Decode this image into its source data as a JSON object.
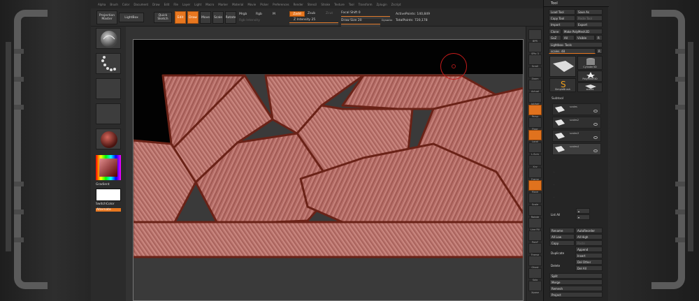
{
  "menu": [
    "Alpha",
    "Brush",
    "Color",
    "Document",
    "Draw",
    "Edit",
    "File",
    "Layer",
    "Light",
    "Macro",
    "Marker",
    "Material",
    "Movie",
    "Picker",
    "Preferences",
    "Render",
    "Stencil",
    "Stroke",
    "Texture",
    "Tool",
    "Transform",
    "Zplugin",
    "Zscript"
  ],
  "toolbar": {
    "projection_master": "Projection Master",
    "lightbox": "LightBox",
    "quick_sketch": "Quick Sketch",
    "edit": "Edit",
    "draw": "Draw",
    "move": "Move",
    "scale": "Scale",
    "rotate": "Rotate",
    "mrgb": "Mrgb",
    "rgb": "Rgb",
    "m": "M",
    "zadd": "Zadd",
    "zsub": "Zsub",
    "zcut": "Zcut",
    "rgb_intensity": "Rgb Intensity",
    "z_intensity": "Z Intensity 25",
    "focal_shift": "Focal Shift 0",
    "draw_size": "Draw Size 20",
    "dynamic": "Dynamic",
    "active_points": "ActivePoints: 140,849",
    "total_points": "TotalPoints: 720,178"
  },
  "left_shelf": {
    "gradient": "Gradient",
    "switch_color": "SwitchColor",
    "alternate": "Alternate"
  },
  "right_shelf": [
    "BPR",
    "SPix 3",
    "Scroll",
    "Zoom",
    "Actual",
    "AAHalf",
    "Persp",
    "Floor",
    "Local",
    "L.Sym",
    "Xyz",
    "Frame",
    "Move",
    "Scale",
    "Rotate",
    "Line Fill",
    "PolyF",
    "Transp",
    "Ghost",
    "Solo",
    "Xpose"
  ],
  "palette": {
    "title": "Tool",
    "load_tool": "Load Tool",
    "save_as": "Save As",
    "copy_tool": "Copy Tool",
    "paste_tool": "Paste Tool",
    "import": "Import",
    "export": "Export",
    "clone": "Clone",
    "make_polymesh": "Make PolyMesh3D",
    "goz": "GoZ",
    "all": "All",
    "visible": "Visible",
    "r": "R",
    "lightbox_tools": "Lightbox› Tools",
    "scales_label": "scales. 48",
    "r2": "R",
    "tile_cylinder": "Cylinder3D",
    "tile_polymesh": "PolyMesh3D",
    "tile_simplebrush": "SimpleBrush",
    "tile_scales": "scales",
    "subtool": "Subtool",
    "subtool_items": [
      "scales",
      "scales2",
      "scales3",
      "scales4"
    ],
    "list_all": "List All",
    "rename": "Rename",
    "autoreorder": "AutoReorder",
    "all_low": "All Low",
    "all_high": "All High",
    "copy": "Copy",
    "paste": "Paste",
    "duplicate": "Duplicate",
    "append": "Append",
    "insert": "Insert",
    "delete": "Delete",
    "del_other": "Del Other",
    "del_all": "Del All",
    "split": "Split",
    "merge": "Merge",
    "remesh": "Remesh",
    "project": "Project"
  },
  "colors": {
    "accent": "#e8771f",
    "mesh": "#b86a64",
    "mesh_dark": "#7a2d22",
    "brush_ring": "#c61b1b"
  }
}
